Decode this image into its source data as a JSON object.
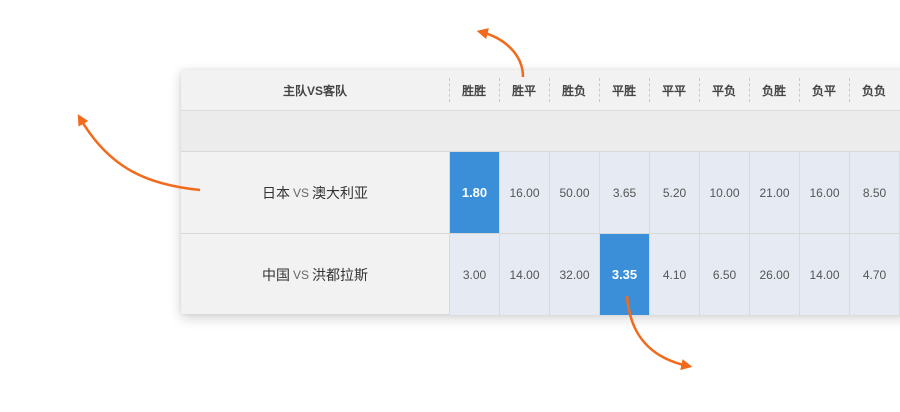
{
  "header": {
    "team_label": "主队VS客队",
    "columns": [
      "胜胜",
      "胜平",
      "胜负",
      "平胜",
      "平平",
      "平负",
      "负胜",
      "负平",
      "负负"
    ]
  },
  "matches": [
    {
      "home": "日本",
      "vs": "VS",
      "away": "澳大利亚",
      "odds": [
        "1.80",
        "16.00",
        "50.00",
        "3.65",
        "5.20",
        "10.00",
        "21.00",
        "16.00",
        "8.50"
      ],
      "selected_index": 0
    },
    {
      "home": "中国",
      "vs": "VS",
      "away": "洪都拉斯",
      "odds": [
        "3.00",
        "14.00",
        "32.00",
        "3.35",
        "4.10",
        "6.50",
        "26.00",
        "14.00",
        "4.70"
      ],
      "selected_index": 3
    }
  ],
  "colors": {
    "accent_selected": "#3b8fd9",
    "arrow": "#f26a1b",
    "odds_cell_bg": "#e5eaf3"
  }
}
